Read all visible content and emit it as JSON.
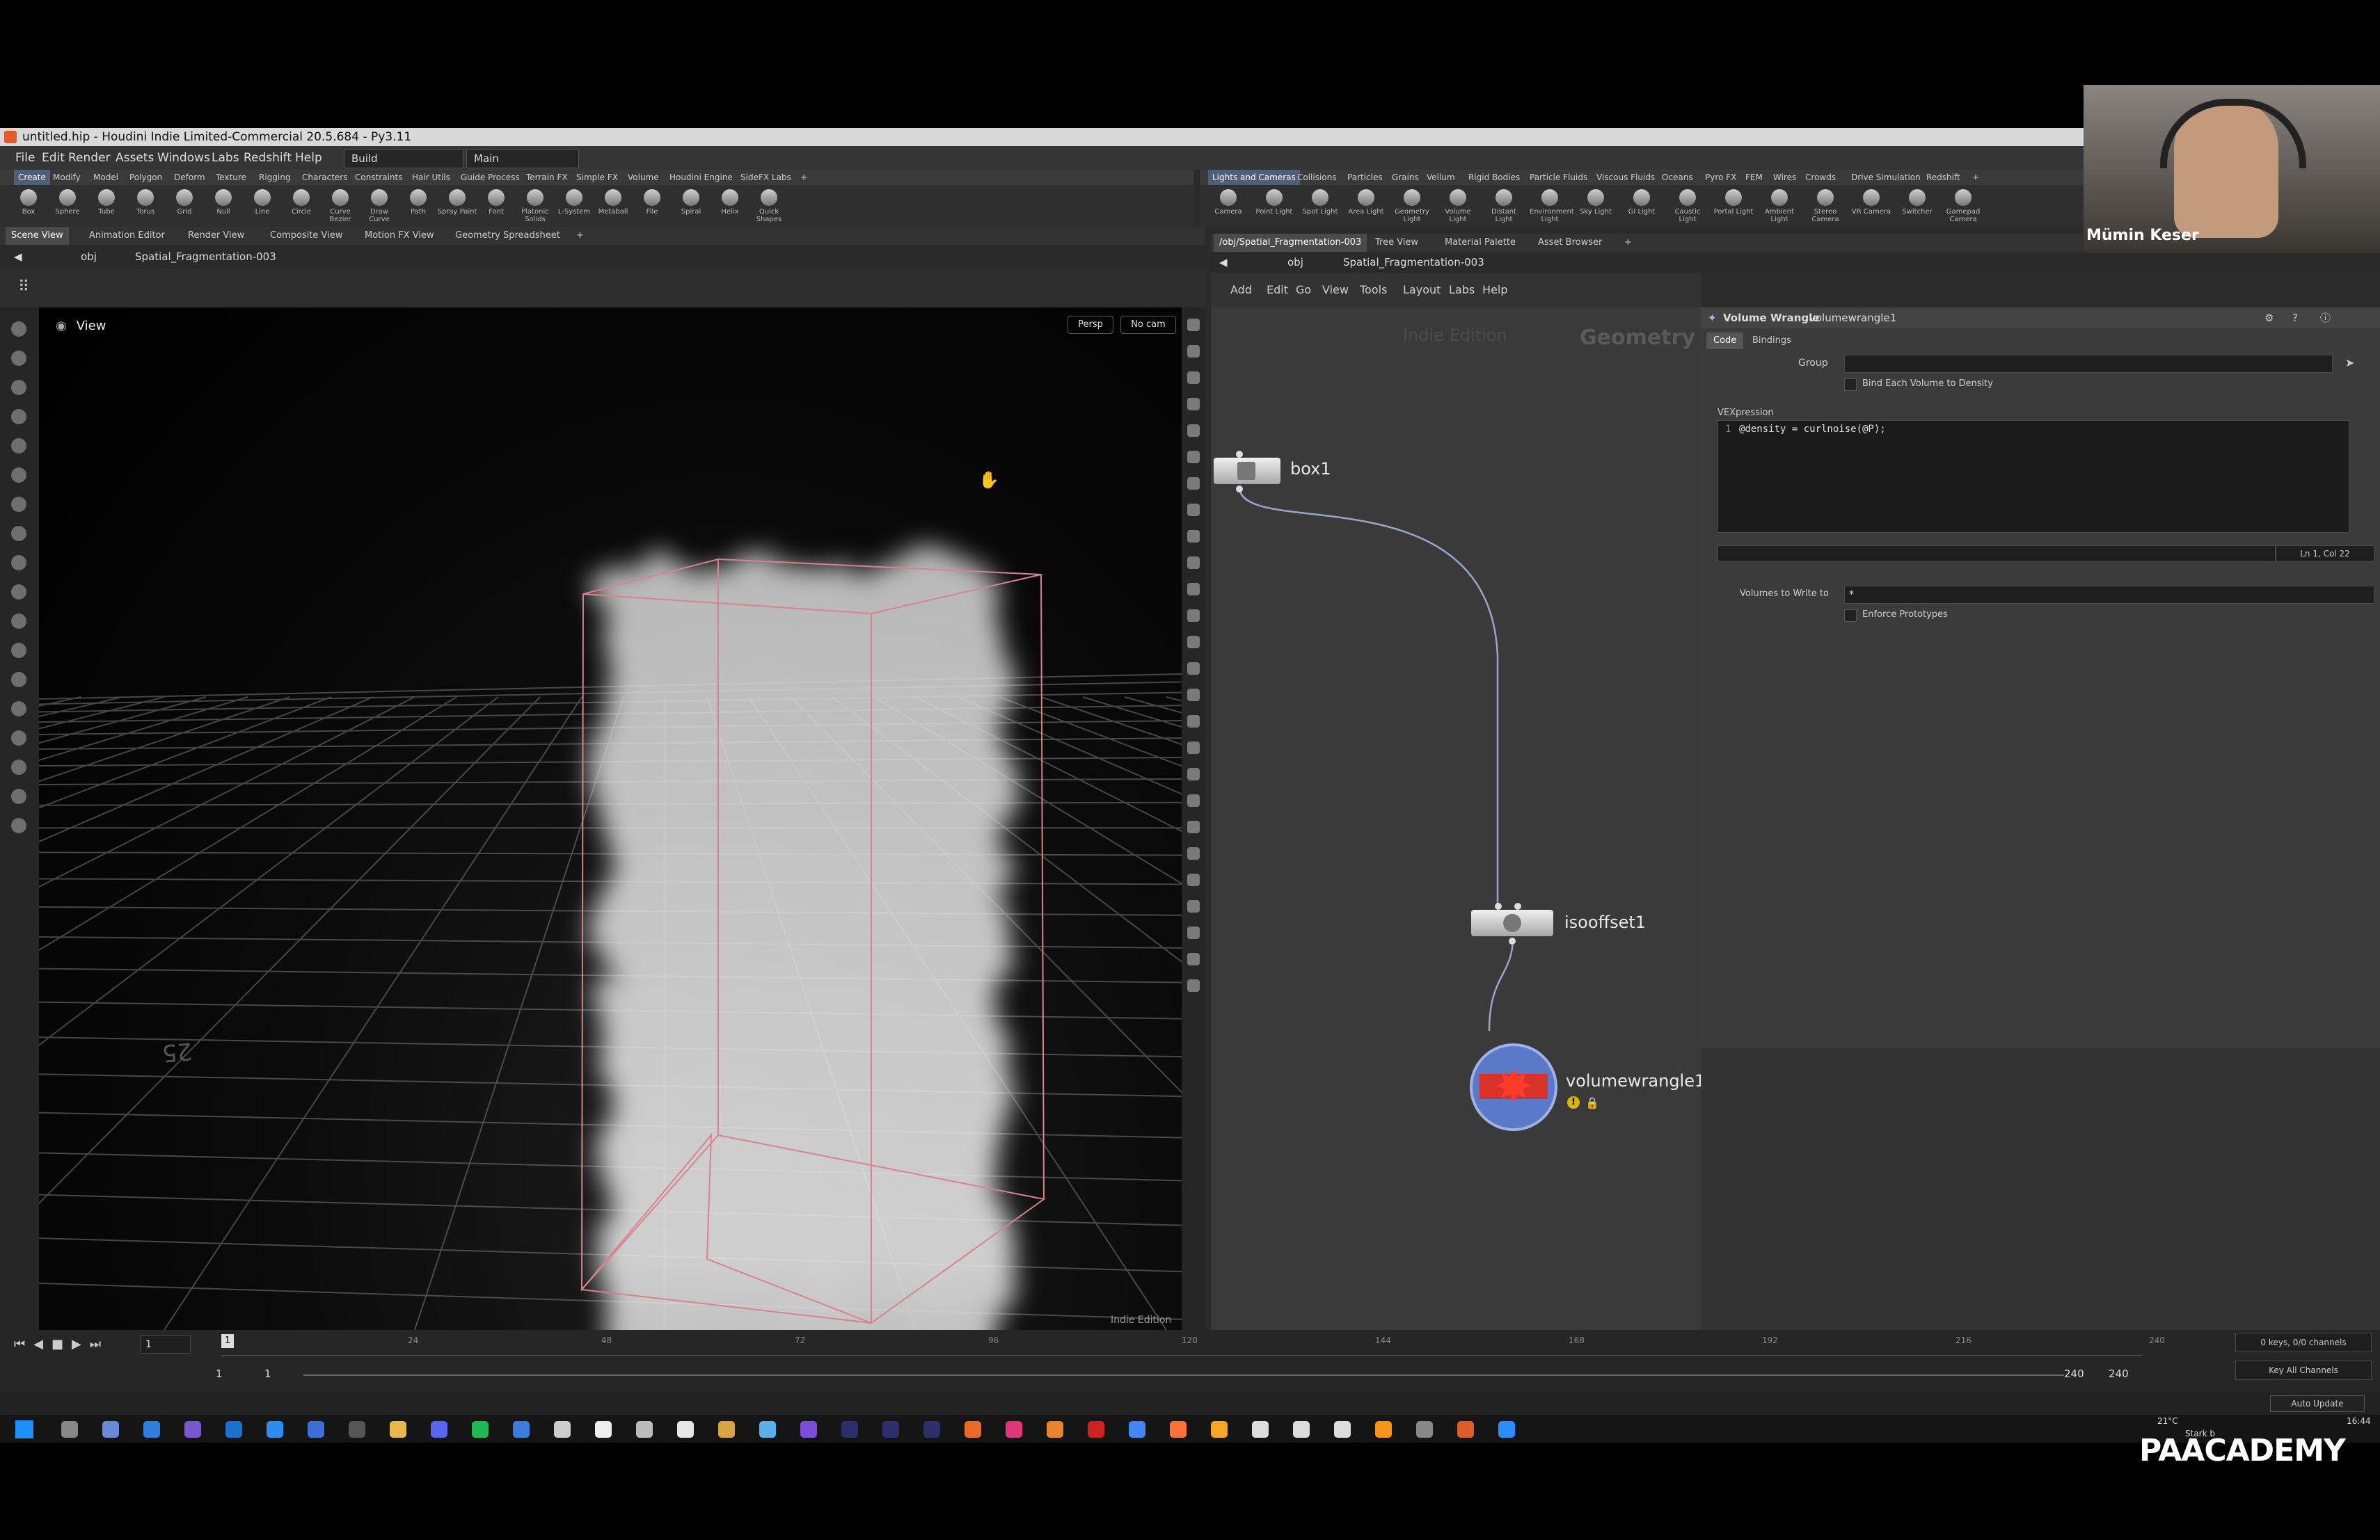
{
  "window": {
    "title": "untitled.hip - Houdini Indie Limited-Commercial 20.5.684 - Py3.11"
  },
  "menu": [
    "File",
    "Edit",
    "Render",
    "Assets",
    "Windows",
    "Labs",
    "Redshift",
    "Help"
  ],
  "desktops": {
    "build": "Build",
    "main": "Main"
  },
  "shelf_tabs_left": [
    "Create",
    "Modify",
    "Model",
    "Polygon",
    "Deform",
    "Texture",
    "Rigging",
    "Characters",
    "Constraints",
    "Hair Utils",
    "Guide Process",
    "Terrain FX",
    "Simple FX",
    "Volume",
    "Houdini Engine",
    "SideFX Labs"
  ],
  "shelf_tabs_right": [
    "Lights and Cameras",
    "Collisions",
    "Particles",
    "Grains",
    "Vellum",
    "Rigid Bodies",
    "Particle Fluids",
    "Viscous Fluids",
    "Oceans",
    "Pyro FX",
    "FEM",
    "Wires",
    "Crowds",
    "Drive Simulation",
    "Redshift"
  ],
  "tools_left": [
    "Box",
    "Sphere",
    "Tube",
    "Torus",
    "Grid",
    "Null",
    "Line",
    "Circle",
    "Curve Bezier",
    "Draw Curve",
    "Path",
    "Spray Paint",
    "Font",
    "Platonic Solids",
    "L-System",
    "Metaball",
    "File",
    "Spiral",
    "Helix",
    "Quick Shapes"
  ],
  "tools_right": [
    "Camera",
    "Point Light",
    "Spot Light",
    "Area Light",
    "Geometry Light",
    "Volume Light",
    "Distant Light",
    "Environment Light",
    "Sky Light",
    "GI Light",
    "Caustic Light",
    "Portal Light",
    "Ambient Light",
    "Stereo Camera",
    "VR Camera",
    "Switcher",
    "Gamepad Camera"
  ],
  "left_tabs": [
    "Scene View",
    "Animation Editor",
    "Render View",
    "Composite View",
    "Motion FX View",
    "Geometry Spreadsheet"
  ],
  "right_tabs": [
    "/obj/Spatial_Fragmentation-003",
    "Tree View",
    "Material Palette",
    "Asset Browser"
  ],
  "left_path": {
    "root": "obj",
    "node": "Spatial_Fragmentation-003"
  },
  "right_path": {
    "root": "obj",
    "node": "Spatial_Fragmentation-003"
  },
  "viewport": {
    "label": "View",
    "persp": "Persp",
    "cam": "No cam",
    "watermark": "Indie Edition",
    "ground_number": "25"
  },
  "network": {
    "menu": [
      "Add",
      "Edit",
      "Go",
      "View",
      "Tools",
      "Layout",
      "Labs",
      "Help"
    ],
    "watermark": "Indie Edition",
    "context": "Geometry",
    "nodes": {
      "box": "box1",
      "isooffset": "isooffset1",
      "volumewrangle": "volumewrangle1"
    }
  },
  "params": {
    "node_type": "Volume Wrangle",
    "node_name": "volumewrangle1",
    "tabs": [
      "Code",
      "Bindings"
    ],
    "group_label": "Group",
    "bind_label": "Bind Each Volume to Density",
    "vex_label": "VEXpression",
    "code_line_no": "1",
    "code": "@density = curlnoise(@P);",
    "cursor_pos": "Ln 1, Col 22",
    "write_label": "Volumes to Write to",
    "write_value": "*",
    "enforce_label": "Enforce Prototypes"
  },
  "timeline": {
    "current_frame": "1",
    "frame_marker": "1",
    "ticks": [
      "24",
      "48",
      "72",
      "96",
      "120",
      "144",
      "168",
      "192",
      "216",
      "240"
    ],
    "start": "1",
    "start2": "1",
    "end": "240",
    "end2": "240",
    "keys": "0 keys, 0/0 channels",
    "key_all": "Key All Channels",
    "auto_update": "Auto Update"
  },
  "webcam": {
    "name": "Mümin Keser"
  },
  "tray": {
    "temp": "21°C",
    "weather": "Stark b",
    "time": "16:44"
  },
  "brand": "PAACADEMY",
  "colors": {
    "accent": "#e15b2a",
    "node_red": "#d8322a",
    "node_ring": "#5b79c9"
  }
}
